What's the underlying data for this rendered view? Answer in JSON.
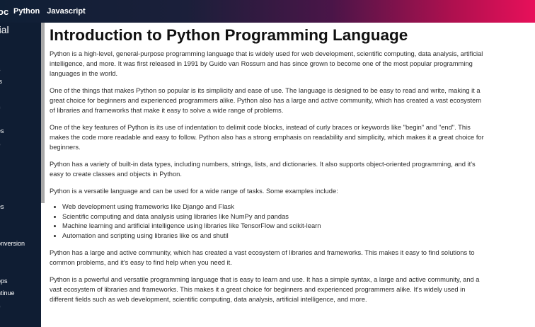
{
  "header": {
    "brand": "oc",
    "nav": [
      "Python",
      "Javascript"
    ]
  },
  "sidebar": {
    "title": "rial",
    "items": [
      "i",
      "s",
      "ts",
      "s",
      "es",
      "s",
      "es",
      "onversion",
      "ops",
      "ntinue",
      "s"
    ]
  },
  "article": {
    "title": "Introduction to Python Programming Language",
    "paragraphs_before_list": [
      "Python is a high-level, general-purpose programming language that is widely used for web development, scientific computing, data analysis, artificial intelligence, and more. It was first released in 1991 by Guido van Rossum and has since grown to become one of the most popular programming languages in the world.",
      "One of the things that makes Python so popular is its simplicity and ease of use. The language is designed to be easy to read and write, making it a great choice for beginners and experienced programmers alike. Python also has a large and active community, which has created a vast ecosystem of libraries and frameworks that make it easy to solve a wide range of problems.",
      "One of the key features of Python is its use of indentation to delimit code blocks, instead of curly braces or keywords like \"begin\" and \"end\". This makes the code more readable and easy to follow. Python also has a strong emphasis on readability and simplicity, which makes it a great choice for beginners.",
      "Python has a variety of built-in data types, including numbers, strings, lists, and dictionaries. It also supports object-oriented programming, and it's easy to create classes and objects in Python.",
      "Python is a versatile language and can be used for a wide range of tasks. Some examples include:"
    ],
    "list_items": [
      "Web development using frameworks like Django and Flask",
      "Scientific computing and data analysis using libraries like NumPy and pandas",
      "Machine learning and artificial intelligence using libraries like TensorFlow and scikit-learn",
      "Automation and scripting using libraries like os and shutil"
    ],
    "paragraphs_after_list": [
      "Python has a large and active community, which has created a vast ecosystem of libraries and frameworks. This makes it easy to find solutions to common problems, and it's easy to find help when you need it.",
      "Python is a powerful and versatile programming language that is easy to learn and use. It has a simple syntax, a large and active community, and a vast ecosystem of libraries and frameworks. This makes it a great choice for beginners and experienced programmers alike. It's widely used in different fields such as web development, scientific computing, data analysis, artificial intelligence, and more."
    ]
  }
}
